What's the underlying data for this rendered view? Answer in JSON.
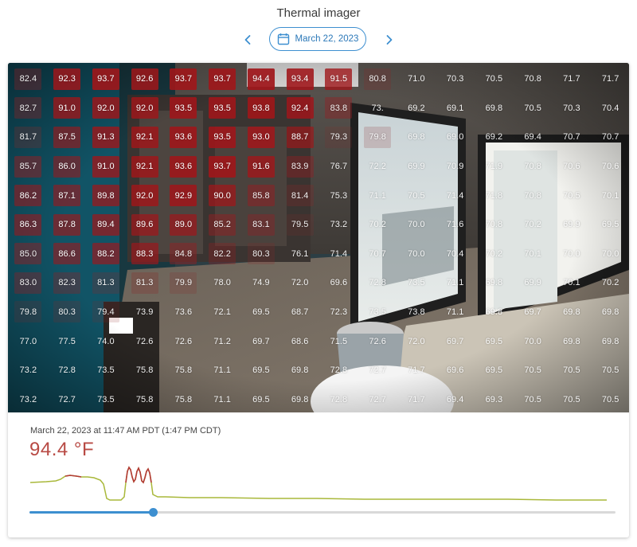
{
  "title": "Thermal imager",
  "date_nav": {
    "date_label": "March 22, 2023",
    "prev_icon": "chevron-left-icon",
    "next_icon": "chevron-right-icon",
    "calendar_icon": "calendar-icon"
  },
  "colors": {
    "accent": "#3d8fd0",
    "hot_text": "#b84a44",
    "line_normal": "#a9b83a",
    "line_hot": "#b33a35"
  },
  "thermal_grid": [
    [
      "82.4",
      "92.3",
      "93.7",
      "92.6",
      "93.7",
      "93.7",
      "94.4",
      "93.4",
      "91.5",
      "80.8",
      "71.0",
      "70.3",
      "70.5",
      "70.8",
      "71.7",
      "71.7"
    ],
    [
      "82.7",
      "91.0",
      "92.0",
      "92.0",
      "93.5",
      "93.5",
      "93.8",
      "92.4",
      "83.8",
      "73.",
      "69.2",
      "69.1",
      "69.8",
      "70.5",
      "70.3",
      "70.4"
    ],
    [
      "81.7",
      "87.5",
      "91.3",
      "92.1",
      "93.6",
      "93.5",
      "93.0",
      "88.7",
      "79.3",
      "79.8",
      "69.8",
      "69.0",
      "69.2",
      "69.4",
      "70.7",
      "70.7"
    ],
    [
      "85.7",
      "86.0",
      "91.0",
      "92.1",
      "93.6",
      "93.7",
      "91.6",
      "83.9",
      "76.7",
      "72.2",
      "69.9",
      "70.9",
      "71.9",
      "70.8",
      "70.6",
      "70.6"
    ],
    [
      "86.2",
      "87.1",
      "89.8",
      "92.0",
      "92.9",
      "90.0",
      "85.8",
      "81.4",
      "75.3",
      "71.1",
      "70.5",
      "71.4",
      "71.8",
      "70.8",
      "70.5",
      "70.1"
    ],
    [
      "86.3",
      "87.8",
      "89.4",
      "89.6",
      "89.0",
      "85.2",
      "83.1",
      "79.5",
      "73.2",
      "70.2",
      "70.0",
      "71.6",
      "70.8",
      "70.2",
      "69.9",
      "69.5"
    ],
    [
      "85.0",
      "86.6",
      "88.2",
      "88.3",
      "84.8",
      "82.2",
      "80.3",
      "76.1",
      "71.4",
      "70.7",
      "70.0",
      "70.4",
      "70.2",
      "70.1",
      "70.0",
      "70.0"
    ],
    [
      "83.0",
      "82.3",
      "81.3",
      "81.3",
      "79.9",
      "78.0",
      "74.9",
      "72.0",
      "69.6",
      "72.8",
      "73.5",
      "71.1",
      "69.8",
      "69.9",
      "70.1",
      "70.2"
    ],
    [
      "79.8",
      "80.3",
      "79.4",
      "73.9",
      "73.6",
      "72.1",
      "69.5",
      "68.7",
      "72.3",
      "73.5",
      "73.8",
      "71.1",
      "69.8",
      "69.7",
      "69.8",
      "69.8"
    ],
    [
      "77.0",
      "77.5",
      "74.0",
      "72.6",
      "72.6",
      "71.2",
      "69.7",
      "68.6",
      "71.5",
      "72.6",
      "72.0",
      "69.7",
      "69.5",
      "70.0",
      "69.8",
      "69.8"
    ],
    [
      "73.2",
      "72.8",
      "73.5",
      "75.8",
      "75.8",
      "71.1",
      "69.5",
      "69.8",
      "72.8",
      "72.7",
      "71.7",
      "69.6",
      "69.5",
      "70.5",
      "70.5",
      "70.5"
    ],
    [
      "73.2",
      "72.7",
      "73.5",
      "75.8",
      "75.8",
      "71.1",
      "69.5",
      "69.8",
      "72.8",
      "72.7",
      "71.7",
      "69.4",
      "69.3",
      "70.5",
      "70.5",
      "70.5"
    ]
  ],
  "reading": {
    "timestamp": "March 22, 2023 at 11:47 AM PDT (1:47 PM CDT)",
    "temperature": "94.4 °F",
    "temperature_value": 94.4
  },
  "timeline": {
    "position": 0.21
  }
}
